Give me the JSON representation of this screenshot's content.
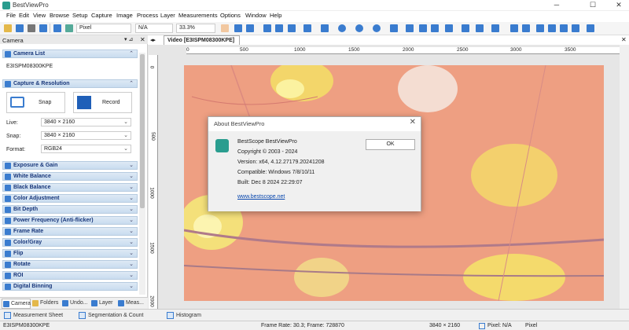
{
  "app": {
    "title": "BestViewPro"
  },
  "window": {
    "minimize": "─",
    "maximize": "☐",
    "close": "✕"
  },
  "menu": [
    "File",
    "Edit",
    "View",
    "Browse",
    "Setup",
    "Capture",
    "Image",
    "Process",
    "Layer",
    "Measurements",
    "Options",
    "Window",
    "Help"
  ],
  "toolbar": {
    "pixel_unit": "Pixel",
    "na": "N/A",
    "zoom": "33.3%"
  },
  "panel": {
    "title": "Camera",
    "camera_list_title": "Camera List",
    "camera_name": "E3ISPM08300KPE",
    "capture_title": "Capture & Resolution",
    "snap_label": "Snap",
    "record_label": "Record",
    "live_label": "Live:",
    "live_value": "3840 × 2160",
    "snap_res_label": "Snap:",
    "snap_res_value": "3840 × 2160",
    "format_label": "Format:",
    "format_value": "RGB24",
    "sections": [
      "Exposure & Gain",
      "White Balance",
      "Black Balance",
      "Color Adjustment",
      "Bit Depth",
      "Power Frequency (Anti-flicker)",
      "Frame Rate",
      "Color/Gray",
      "Flip",
      "Rotate",
      "ROI",
      "Digital Binning"
    ]
  },
  "bottom_tabs": [
    "Camera",
    "Folders",
    "Undo...",
    "Layer",
    "Meas..."
  ],
  "document": {
    "tab_title": "Video [E3ISPM08300KPE]"
  },
  "ruler": {
    "h_ticks": [
      "0",
      "500",
      "1000",
      "1500",
      "2000",
      "2500",
      "3000",
      "3500"
    ],
    "v_ticks": [
      "0",
      "500",
      "1000",
      "1500",
      "2000"
    ]
  },
  "sheet_tabs": [
    "Measurement Sheet",
    "Segmentation & Count",
    "Histogram"
  ],
  "status": {
    "camera": "E3ISPM08300KPE",
    "frame": "Frame Rate: 30.3; Frame: 728870",
    "resolution": "3840 × 2160",
    "pixel": "Pixel: N/A",
    "unit": "Pixel"
  },
  "dialog": {
    "title": "About BestViewPro",
    "product": "BestScope BestViewPro",
    "copyright": "Copyright © 2003 - 2024",
    "version": "Version: x64, 4.12.27179.20241208",
    "compatible": "Compatible: Windows 7/8/10/11",
    "built": "Built: Dec  8 2024 22:29:07",
    "website": "www.bestscope.net",
    "ok": "OK"
  },
  "colors": {
    "accent": "#3a7ccf",
    "section_text": "#17367a",
    "brand": "#2a9d8f"
  }
}
